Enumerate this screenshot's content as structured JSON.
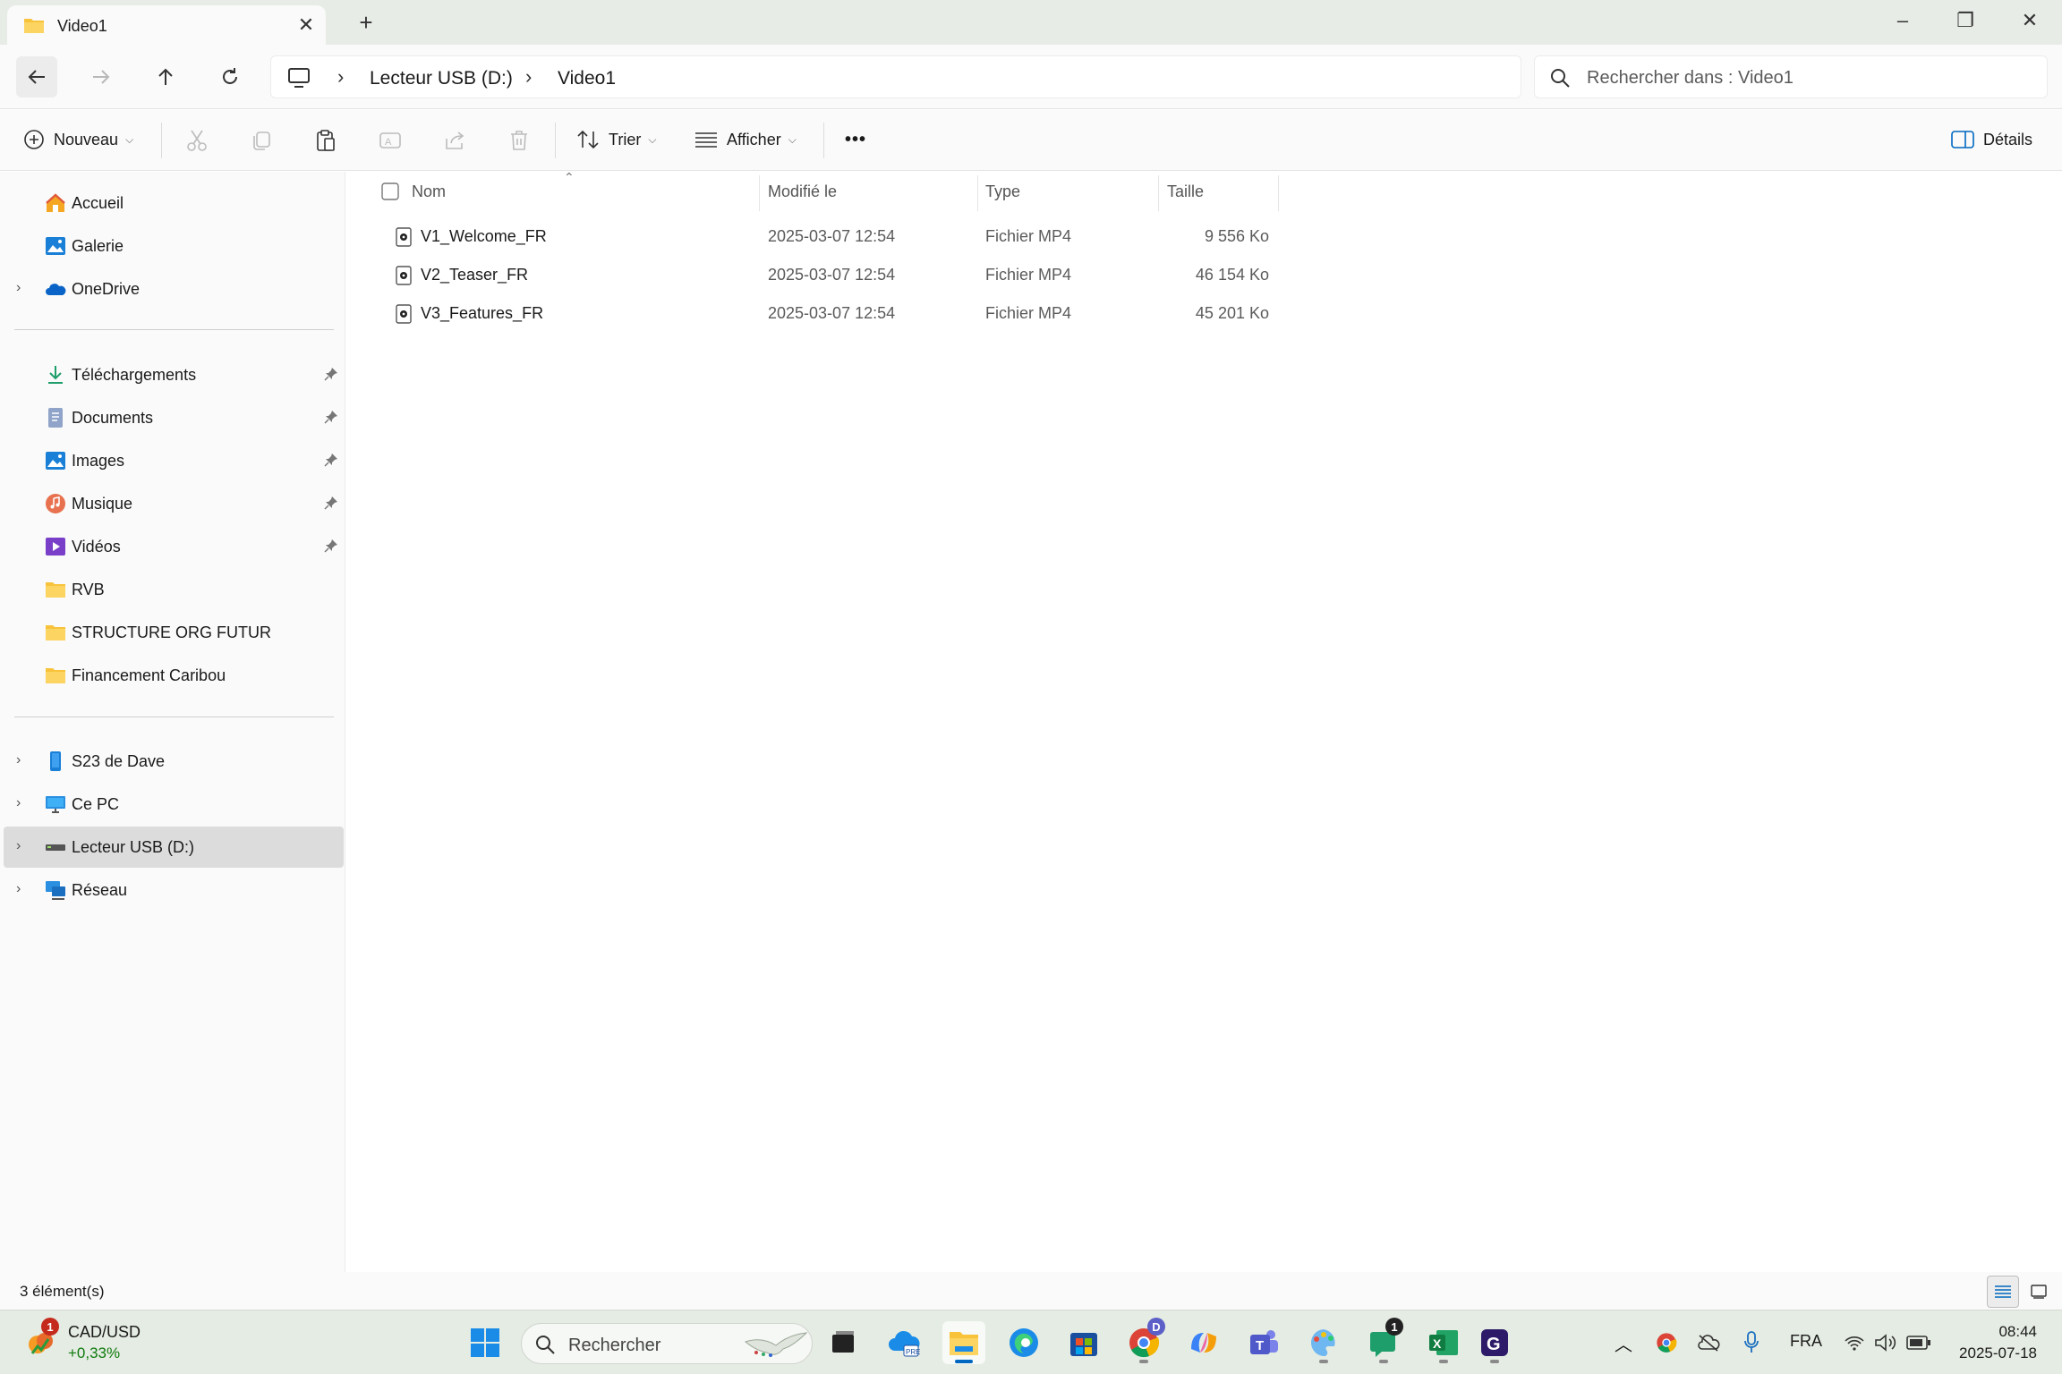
{
  "window": {
    "tab_title": "Video1",
    "minimize": "–",
    "maximize": "❐",
    "close": "✕"
  },
  "nav": {
    "breadcrumb": [
      "Lecteur USB (D:)",
      "Video1"
    ],
    "search_placeholder": "Rechercher dans : Video1"
  },
  "toolbar": {
    "new_label": "Nouveau",
    "sort_label": "Trier",
    "view_label": "Afficher",
    "more_label": "•••",
    "details_label": "Détails"
  },
  "sidebar": {
    "quick": [
      {
        "label": "Accueil",
        "icon": "home-icon"
      },
      {
        "label": "Galerie",
        "icon": "gallery-icon"
      },
      {
        "label": "OneDrive",
        "icon": "onedrive-icon"
      }
    ],
    "pinned": [
      {
        "label": "Téléchargements",
        "icon": "download-icon"
      },
      {
        "label": "Documents",
        "icon": "documents-icon"
      },
      {
        "label": "Images",
        "icon": "images-icon"
      },
      {
        "label": "Musique",
        "icon": "music-icon"
      },
      {
        "label": "Vidéos",
        "icon": "videos-icon"
      },
      {
        "label": "RVB",
        "icon": "folder-icon"
      },
      {
        "label": "STRUCTURE ORG FUTUR",
        "icon": "folder-icon"
      },
      {
        "label": "Financement Caribou",
        "icon": "folder-icon"
      }
    ],
    "devices": [
      {
        "label": "S23 de Dave",
        "icon": "phone-icon"
      },
      {
        "label": "Ce PC",
        "icon": "pc-icon"
      },
      {
        "label": "Lecteur USB (D:)",
        "icon": "usb-drive-icon"
      },
      {
        "label": "Réseau",
        "icon": "network-icon"
      }
    ]
  },
  "columns": {
    "name": "Nom",
    "modified": "Modifié le",
    "type": "Type",
    "size": "Taille"
  },
  "files": [
    {
      "name": "V1_Welcome_FR",
      "modified": "2025-03-07 12:54",
      "type": "Fichier MP4",
      "size": "9 556 Ko"
    },
    {
      "name": "V2_Teaser_FR",
      "modified": "2025-03-07 12:54",
      "type": "Fichier MP4",
      "size": "46 154 Ko"
    },
    {
      "name": "V3_Features_FR",
      "modified": "2025-03-07 12:54",
      "type": "Fichier MP4",
      "size": "45 201 Ko"
    }
  ],
  "status": {
    "count": "3 élément(s)"
  },
  "taskbar": {
    "widget_title": "CAD/USD",
    "widget_value": "+0,33%",
    "widget_badge": "1",
    "search_label": "Rechercher",
    "chrome_badge": "D",
    "chat_badge": "1",
    "language": "FRA",
    "time": "08:44",
    "date": "2025-07-18"
  },
  "colors": {
    "accent": "#0067c0",
    "folder": "#f8c33a",
    "excel": "#107c41",
    "teams": "#5059c9"
  }
}
